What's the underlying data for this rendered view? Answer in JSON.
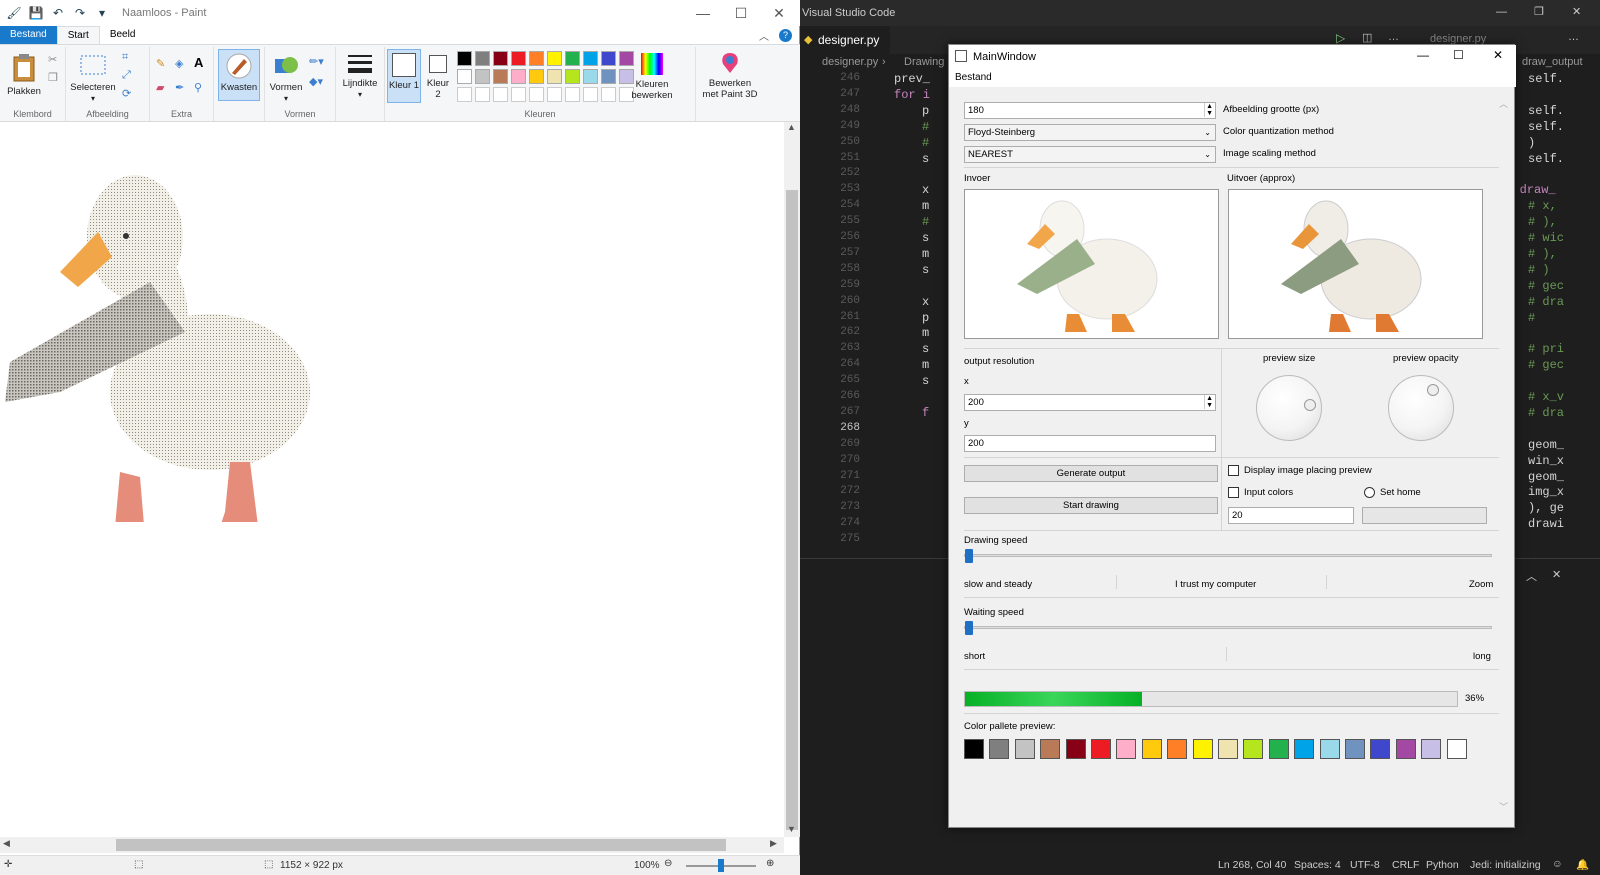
{
  "paint": {
    "title": "Naamloos - Paint",
    "menu": {
      "file": "Bestand",
      "start": "Start",
      "view": "Beeld"
    },
    "ribbon": {
      "paste": "Plakken",
      "select": "Selecteren",
      "brushes": "Kwasten",
      "shapes": "Vormen",
      "line_width": "Lijndikte",
      "color1": "Kleur 1",
      "color2": "Kleur 2",
      "edit_colors": "Kleuren bewerken",
      "paint3d": "Bewerken met Paint 3D",
      "groups": {
        "clipboard": "Klembord",
        "image": "Afbeelding",
        "tools": "Extra",
        "shapes": "Vormen",
        "colors": "Kleuren"
      }
    },
    "palette_row1": [
      "#000000",
      "#7f7f7f",
      "#880015",
      "#ed1c24",
      "#ff7f27",
      "#fff200",
      "#22b14c",
      "#00a2e8",
      "#3f48cc",
      "#a349a4"
    ],
    "palette_row2": [
      "#ffffff",
      "#c3c3c3",
      "#b97a57",
      "#ffaec9",
      "#ffc90e",
      "#efe4b0",
      "#b5e61d",
      "#99d9ea",
      "#7092be",
      "#c8bfe7"
    ],
    "status": {
      "size": "1152 × 922 px",
      "zoom": "100%"
    }
  },
  "vscode": {
    "title": "Visual Studio Code",
    "tab": "designer.py",
    "tab2": "designer.py",
    "breadcrumb": {
      "file": "designer.py",
      "symbol": "Drawing",
      "right": "draw_output"
    },
    "line_numbers": [
      "246",
      "247",
      "248",
      "249",
      "250",
      "251",
      "252",
      "253",
      "254",
      "255",
      "256",
      "257",
      "258",
      "259",
      "260",
      "261",
      "262",
      "263",
      "264",
      "265",
      "266",
      "267",
      "268",
      "269",
      "270",
      "271",
      "272",
      "273",
      "274",
      "275"
    ],
    "code_left": [
      "prev_",
      "for i",
      "p",
      "#",
      "#",
      "s",
      "",
      "x",
      "m",
      "#",
      "s",
      "m",
      "s",
      "",
      "x",
      "p",
      "m",
      "s",
      "m",
      "s",
      "",
      "f"
    ],
    "code_right": [
      "self.",
      "",
      "self.",
      "self.",
      ")",
      "self.",
      "",
      "ef draw_",
      "# x,",
      "# ),",
      "# wic",
      "# ),",
      "# )",
      "# gec",
      "# dra",
      "#",
      "",
      "# pri",
      "# gec",
      "",
      "# x_v",
      "# dra",
      "",
      "geom_",
      "win_x",
      "geom_",
      "img_x",
      "), ge",
      "drawi"
    ],
    "status": {
      "pos": "Ln 268, Col 40",
      "spaces": "Spaces: 4",
      "enc": "UTF-8",
      "eol": "CRLF",
      "lang": "Python",
      "ls": "Jedi: initializing"
    }
  },
  "mainwindow": {
    "title": "MainWindow",
    "menu": "Bestand",
    "size_value": "180",
    "size_label": "Afbeelding grootte (px)",
    "quant_value": "Floyd-Steinberg",
    "quant_label": "Color quantization method",
    "scale_value": "NEAREST",
    "scale_label": "Image scaling method",
    "input_label": "Invoer",
    "output_label": "Uitvoer (approx)",
    "output_resolution": "output resolution",
    "x_label": "x",
    "x_value": "200",
    "y_label": "y",
    "y_value": "200",
    "preview_size": "preview size",
    "preview_opacity": "preview opacity",
    "generate": "Generate output",
    "start": "Start drawing",
    "display_preview": "Display image placing preview",
    "input_colors": "Input colors",
    "input_colors_value": "20",
    "set_home": "Set home",
    "drawing_speed": "Drawing speed",
    "speed_labels": [
      "slow and steady",
      "I trust my computer",
      "Zoom"
    ],
    "waiting_speed": "Waiting speed",
    "wait_labels": [
      "short",
      "long"
    ],
    "progress": 36,
    "progress_text": "36%",
    "palette_label": "Color pallete preview:",
    "palette": [
      "#000000",
      "#7f7f7f",
      "#c3c3c3",
      "#b97a57",
      "#880015",
      "#ed1c24",
      "#ffaec9",
      "#ffc90e",
      "#ff7f27",
      "#fff200",
      "#efe4b0",
      "#b5e61d",
      "#22b14c",
      "#00a2e8",
      "#99d9ea",
      "#7092be",
      "#3f48cc",
      "#a349a4",
      "#c8bfe7",
      "#ffffff"
    ]
  }
}
